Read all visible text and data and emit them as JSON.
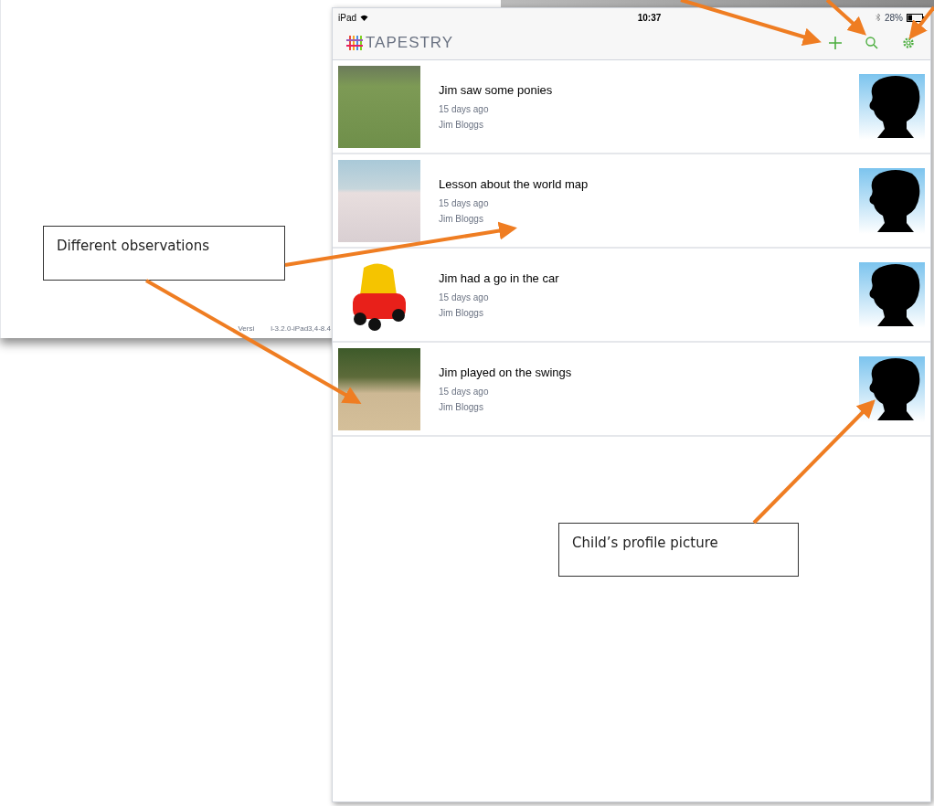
{
  "background_window": {
    "version_text": [
      "Versi",
      "l-3.2.0-iPad3,4-8.4"
    ]
  },
  "status_bar": {
    "device": "iPad",
    "time": "10:37",
    "battery": "28%"
  },
  "nav_bar": {
    "logo": "TAPESTRY"
  },
  "observations": [
    {
      "title": "Jim saw some ponies",
      "time": "15 days ago",
      "author": "Jim Bloggs"
    },
    {
      "title": "Lesson about the world map",
      "time": "15 days ago",
      "author": "Jim Bloggs"
    },
    {
      "title": "Jim had a go in the car",
      "time": "15 days ago",
      "author": "Jim Bloggs"
    },
    {
      "title": "Jim played on the swings",
      "time": "15 days ago",
      "author": "Jim Bloggs"
    }
  ],
  "callouts": [
    {
      "text": "Different observations"
    },
    {
      "text": "Child’s profile picture"
    }
  ]
}
